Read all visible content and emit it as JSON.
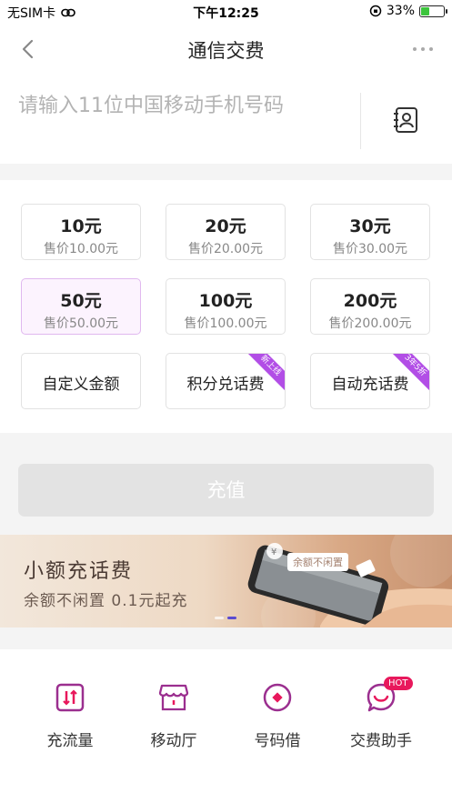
{
  "status_bar": {
    "carrier": "无SIM卡",
    "time": "下午12:25",
    "battery": "33%",
    "battery_level": 0.33
  },
  "nav": {
    "title": "通信交费",
    "back_icon": "chevron-left-icon",
    "more_icon": "more-dots-icon"
  },
  "phone": {
    "placeholder": "请输入11位中国移动手机号码",
    "value": "",
    "contacts_icon": "contacts-book-icon"
  },
  "amounts": [
    {
      "label": "10元",
      "price": "售价10.00元"
    },
    {
      "label": "20元",
      "price": "售价20.00元"
    },
    {
      "label": "30元",
      "price": "售价30.00元"
    },
    {
      "label": "50元",
      "price": "售价50.00元",
      "selected": true
    },
    {
      "label": "100元",
      "price": "售价100.00元"
    },
    {
      "label": "200元",
      "price": "售价200.00元"
    }
  ],
  "extra_options": [
    {
      "label": "自定义金额"
    },
    {
      "label": "积分兑话费",
      "badge": "新上线"
    },
    {
      "label": "自动充话费",
      "badge": "3年5折"
    }
  ],
  "recharge_button": "充值",
  "banner": {
    "title": "小额充话费",
    "subtitle": "余额不闲置  0.1元起充",
    "pill": "余额不闲置"
  },
  "quick_links": [
    {
      "label": "充流量",
      "icon": "data-traffic-icon"
    },
    {
      "label": "移动厅",
      "icon": "store-icon"
    },
    {
      "label": "号码借",
      "icon": "number-loan-icon"
    },
    {
      "label": "交费助手",
      "icon": "assistant-icon",
      "badge": "HOT"
    }
  ],
  "colors": {
    "accent": "#9b2f8f",
    "selected_bg": "#fcf3fe",
    "ribbon": "#b24ee6",
    "hot_badge": "#e8185c",
    "disabled_button": "#e3e3e3"
  }
}
